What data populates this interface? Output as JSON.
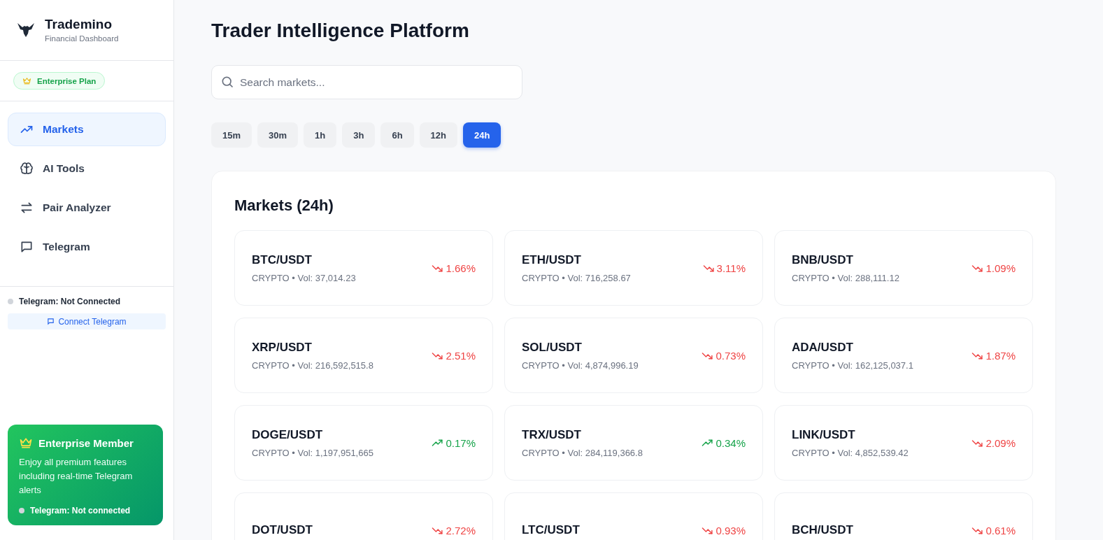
{
  "brand": {
    "name": "Trademino",
    "subtitle": "Financial Dashboard"
  },
  "plan_badge": {
    "label": "Enterprise Plan"
  },
  "nav": [
    {
      "label": "Markets",
      "selected": true
    },
    {
      "label": "AI Tools",
      "selected": false
    },
    {
      "label": "Pair Analyzer",
      "selected": false
    },
    {
      "label": "Telegram",
      "selected": false
    }
  ],
  "telegram_status": {
    "label": "Telegram: Not Connected",
    "connected": false,
    "button": "Connect Telegram"
  },
  "member_card": {
    "title": "Enterprise Member",
    "text": "Enjoy all premium features including real-time Telegram alerts",
    "status": "Telegram: Not connected",
    "connected": false
  },
  "page_title": "Trader Intelligence Platform",
  "search": {
    "placeholder": "Search markets..."
  },
  "timeframes": [
    {
      "label": "15m",
      "selected": false
    },
    {
      "label": "30m",
      "selected": false
    },
    {
      "label": "1h",
      "selected": false
    },
    {
      "label": "3h",
      "selected": false
    },
    {
      "label": "6h",
      "selected": false
    },
    {
      "label": "12h",
      "selected": false
    },
    {
      "label": "24h",
      "selected": true
    }
  ],
  "markets": {
    "title": "Markets (24h)",
    "items": [
      {
        "pair": "BTC/USDT",
        "meta": "CRYPTO • Vol: 37,014.23",
        "change": "1.66%",
        "kind": "down"
      },
      {
        "pair": "ETH/USDT",
        "meta": "CRYPTO • Vol: 716,258.67",
        "change": "3.11%",
        "kind": "down"
      },
      {
        "pair": "BNB/USDT",
        "meta": "CRYPTO • Vol: 288,111.12",
        "change": "1.09%",
        "kind": "down"
      },
      {
        "pair": "XRP/USDT",
        "meta": "CRYPTO • Vol: 216,592,515.8",
        "change": "2.51%",
        "kind": "down"
      },
      {
        "pair": "SOL/USDT",
        "meta": "CRYPTO • Vol: 4,874,996.19",
        "change": "0.73%",
        "kind": "down"
      },
      {
        "pair": "ADA/USDT",
        "meta": "CRYPTO • Vol: 162,125,037.1",
        "change": "1.87%",
        "kind": "down"
      },
      {
        "pair": "DOGE/USDT",
        "meta": "CRYPTO • Vol: 1,197,951,665",
        "change": "0.17%",
        "kind": "up"
      },
      {
        "pair": "TRX/USDT",
        "meta": "CRYPTO • Vol: 284,119,366.8",
        "change": "0.34%",
        "kind": "up"
      },
      {
        "pair": "LINK/USDT",
        "meta": "CRYPTO • Vol: 4,852,539.42",
        "change": "2.09%",
        "kind": "down"
      },
      {
        "pair": "DOT/USDT",
        "change": "2.72%",
        "kind": "down"
      },
      {
        "pair": "LTC/USDT",
        "change": "0.93%",
        "kind": "down"
      },
      {
        "pair": "BCH/USDT",
        "change": "0.61%",
        "kind": "down"
      }
    ]
  }
}
